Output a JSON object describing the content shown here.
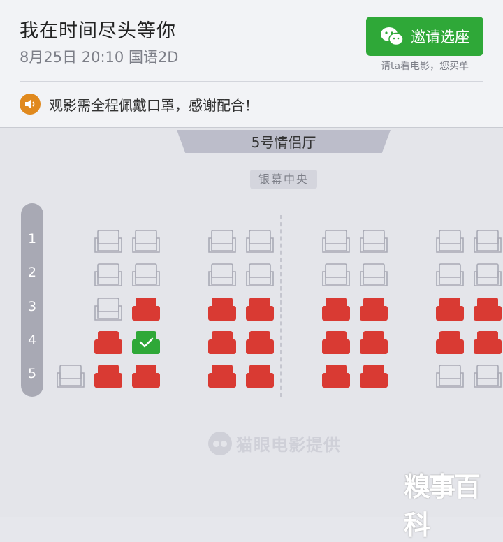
{
  "header": {
    "movie_title": "我在时间尽头等你",
    "showtime": "8月25日 20:10 国语2D",
    "invite_button": "邀请选座",
    "invite_sub": "请ta看电影，您买单"
  },
  "notice": {
    "text": "观影需全程佩戴口罩，感谢配合！",
    "icon": "speaker-icon"
  },
  "hall": {
    "name": "5号情侣厅",
    "screen_label": "银幕中央"
  },
  "rows": [
    "1",
    "2",
    "3",
    "4",
    "5"
  ],
  "seat_status_colors": {
    "available": "#e4e5ea",
    "sold": "#d93a33",
    "selected": "#2fa838"
  },
  "seat_map": [
    [
      "",
      "A",
      "A",
      "A",
      "A",
      "A",
      "A",
      "A",
      "A"
    ],
    [
      "",
      "A",
      "A",
      "A",
      "A",
      "A",
      "A",
      "A",
      "A"
    ],
    [
      "",
      "A",
      "S",
      "S",
      "S",
      "S",
      "S",
      "S",
      "S"
    ],
    [
      "",
      "S",
      "M",
      "S",
      "S",
      "S",
      "S",
      "S",
      "S"
    ],
    [
      "A",
      "S",
      "S",
      "S",
      "S",
      "S",
      "S",
      "A",
      "A"
    ]
  ],
  "seat_legend": {
    "A": "available",
    "S": "sold",
    "M": "selected"
  },
  "footer": {
    "brand": "猫眼电影提供",
    "watermark": "糗事百科"
  }
}
